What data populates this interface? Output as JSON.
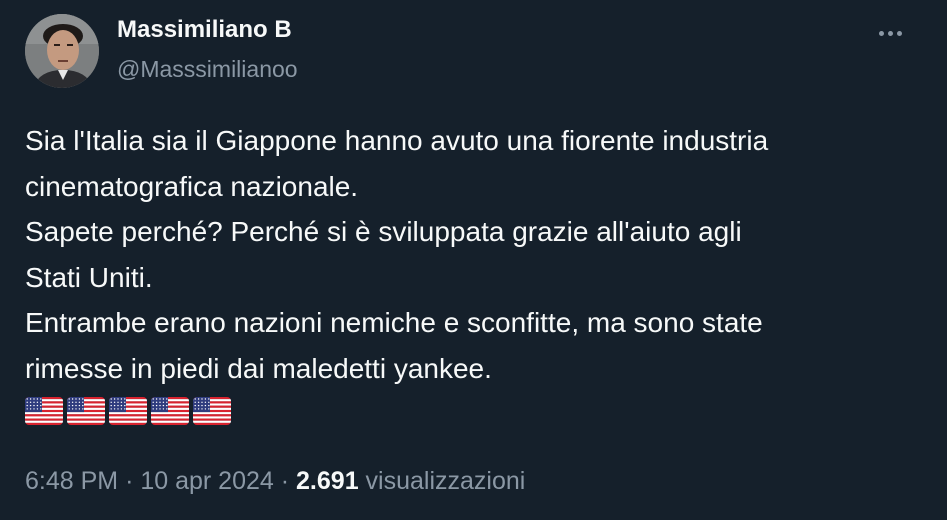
{
  "author": {
    "display_name": "Massimiliano B",
    "handle": "@Masssimilianoo",
    "avatar_icon": "profile-photo"
  },
  "more_icon": "more-horizontal-icon",
  "tweet": {
    "lines": [
      "Sia l'Italia sia il Giappone hanno avuto una fiorente industria",
      "cinematografica nazionale.",
      "Sapete perché? Perché si è sviluppata grazie all'aiuto agli",
      "Stati Uniti.",
      "Entrambe erano nazioni nemiche e sconfitte, ma sono state",
      "rimesse in piedi dai maledetti yankee."
    ],
    "flag_emoji": "us-flag",
    "flag_count": 5
  },
  "meta": {
    "time": "6:48 PM",
    "separator": "·",
    "date": "10 apr 2024",
    "views_count": "2.691",
    "views_label": "visualizzazioni"
  },
  "colors": {
    "background": "#15202b",
    "primary_text": "#f7f9f9",
    "secondary_text": "#8b98a5"
  }
}
